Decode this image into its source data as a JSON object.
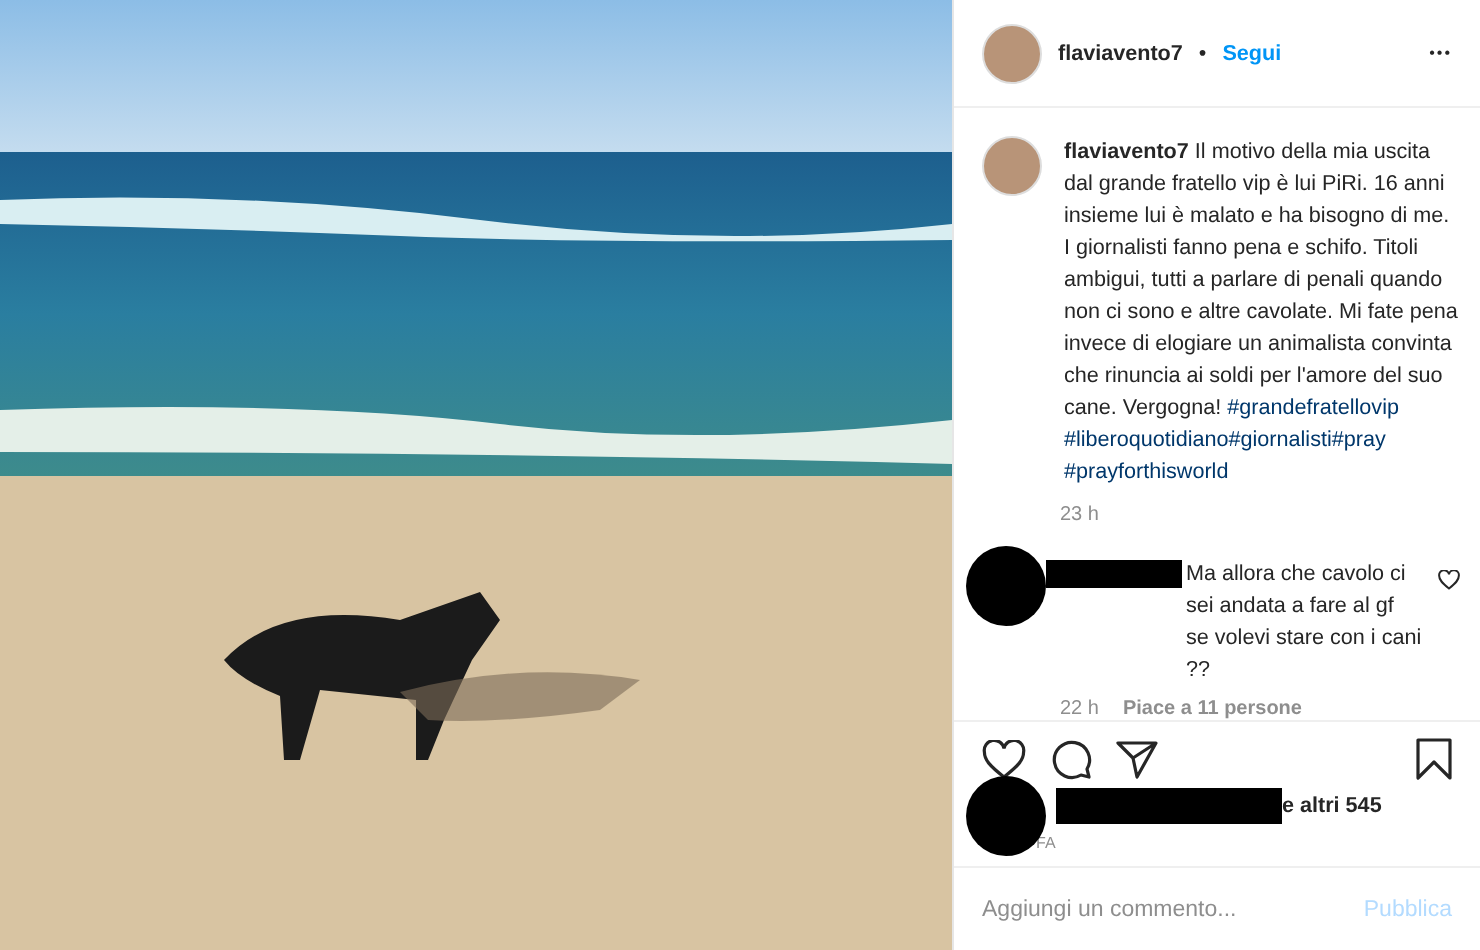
{
  "header": {
    "username": "flaviavento7",
    "separator": "•",
    "follow": "Segui",
    "more": "•••"
  },
  "caption": {
    "username": "flaviavento7",
    "text": "Il motivo della mia uscita dal grande fratello vip è lui PiRi. 16 anni insieme lui è malato e ha bisogno di me. I giornalisti fanno pena e schifo. Titoli ambigui, tutti a parlare di penali quando non ci sono e altre cavolate. Mi fate pena invece di elogiare un animalista convinta che rinuncia ai soldi per l'amore del suo cane. Vergogna!",
    "hashtags": [
      "#grandefratellovip",
      "#liberoquotidiano",
      "#giornalisti",
      "#pray",
      "#prayforthisworld"
    ],
    "time": "23 h"
  },
  "comments": [
    {
      "text": "Ma allora che cavolo ci sei andata a fare al gf se volevi stare con i cani ??",
      "time": "22 h",
      "likes": "Piace a 11 persone",
      "liked": false
    }
  ],
  "likes": {
    "text": "e altri 545",
    "date": "FA"
  },
  "add_comment": {
    "placeholder": "Aggiungi un commento...",
    "button": "Pubblica",
    "disabled": true
  }
}
